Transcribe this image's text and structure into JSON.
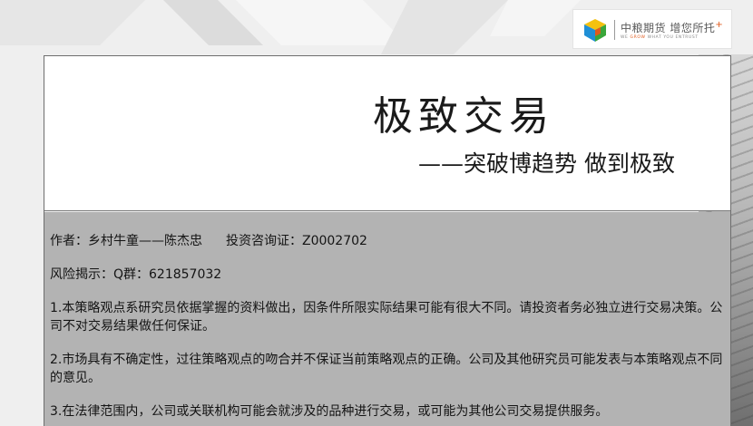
{
  "logo": {
    "name": "中粮期货",
    "slogan": "增您所托",
    "tagline_prefix": "WE",
    "tagline_highlight": "GROW",
    "tagline_suffix": "WHAT YOU ENTRUST",
    "plus": "+"
  },
  "header": {
    "title": "极致交易",
    "subtitle": "——突破博趋势  做到极致"
  },
  "body": {
    "author": "作者：乡村牛童——陈杰忠",
    "license": "投资咨询证：Z0002702",
    "risk": "风险揭示：Q群：621857032",
    "disclaimers": [
      "1.本策略观点系研究员依据掌握的资料做出，因条件所限实际结果可能有很大不同。请投资者务必独立进行交易决策。公司不对交易结果做任何保证。",
      "2.市场具有不确定性，过往策略观点的吻合并不保证当前策略观点的正确。公司及其他研究员可能发表与本策略观点不同的意见。",
      "3.在法律范围内，公司或关联机构可能会就涉及的品种进行交易，或可能为其他公司交易提供服务。"
    ]
  },
  "colors": {
    "background": "#efefef",
    "body_panel": "#b3b3b3",
    "accent": "#e05a1c"
  }
}
